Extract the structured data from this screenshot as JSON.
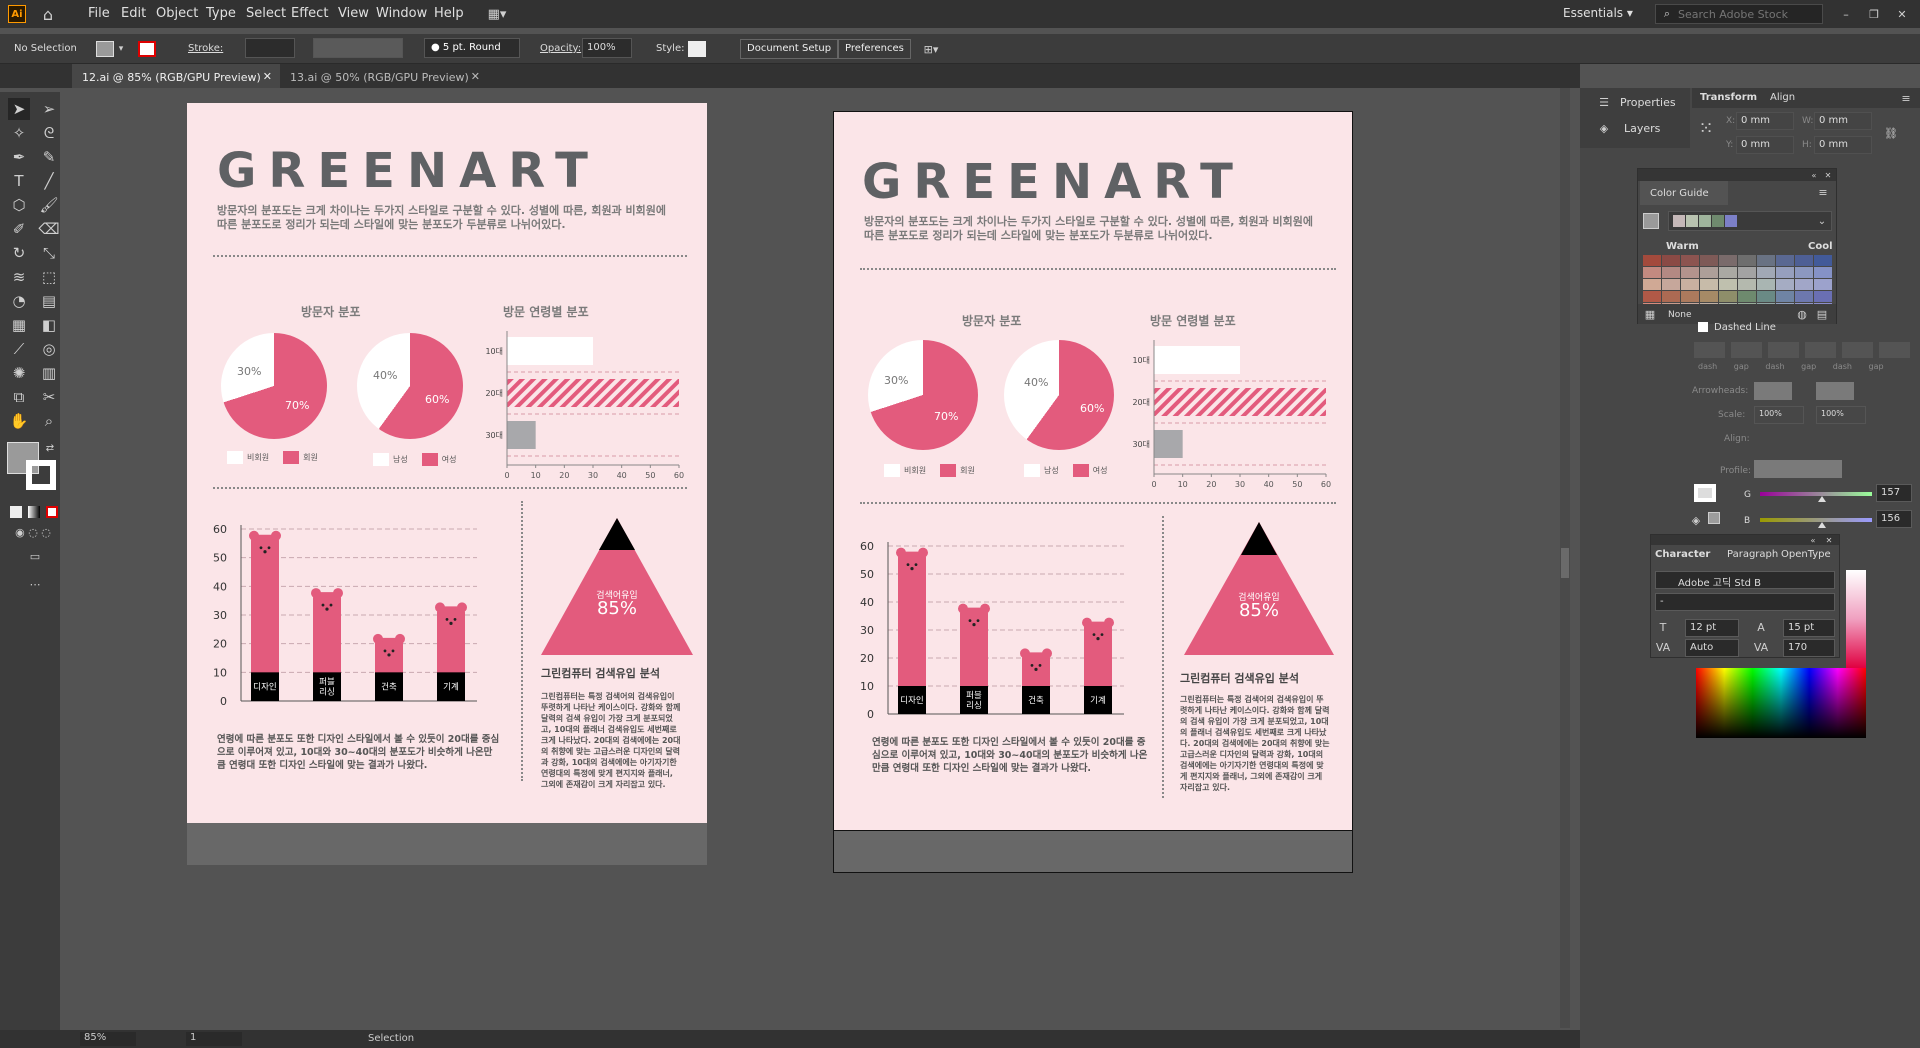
{
  "app": {
    "menu": [
      "File",
      "Edit",
      "Object",
      "Type",
      "Select",
      "Effect",
      "View",
      "Window",
      "Help"
    ],
    "workspace": "Essentials",
    "search_placeholder": "Search Adobe Stock",
    "logo": "Ai"
  },
  "control": {
    "selection": "No Selection",
    "stroke_label": "Stroke:",
    "brush": "5 pt. Round",
    "opacity_label": "Opacity:",
    "opacity": "100%",
    "style_label": "Style:",
    "doc_setup": "Document Setup",
    "preferences": "Preferences"
  },
  "tabs": [
    {
      "label": "12.ai @ 85% (RGB/GPU Preview)"
    },
    {
      "label": "13.ai @ 50% (RGB/GPU Preview)"
    }
  ],
  "status": {
    "zoom": "85%",
    "page": "1",
    "tool": "Selection"
  },
  "art": {
    "title": "GREENART",
    "intro1": "방문자의 분포도는 크게 차이나는 두가지 스타일로 구분할 수 있다. 성별에 따른, 회원과 비회원에",
    "intro2": "따른 분포도로 정리가 되는데 스타일에 맞는 분포도가 두분류로 나뉘어있다.",
    "visitor_title": "방문자 분포",
    "age_title": "방문 연령별 분포",
    "pie1": {
      "a": "30%",
      "b": "70%",
      "a_val": 30,
      "b_val": 70,
      "leg_a": "비회원",
      "leg_b": "회원"
    },
    "pie2": {
      "a": "40%",
      "b": "60%",
      "a_val": 40,
      "b_val": 60,
      "leg_a": "남성",
      "leg_b": "여성"
    },
    "age_bars": {
      "labels": [
        "10대",
        "20대",
        "30대"
      ],
      "values": [
        30,
        60,
        10
      ],
      "ticks": [
        "0",
        "10",
        "20",
        "30",
        "40",
        "50",
        "60"
      ]
    },
    "bear": {
      "ticks": [
        "0",
        "10",
        "20",
        "30",
        "40",
        "50",
        "60"
      ],
      "labels": [
        "디자인",
        "퍼블\n리싱",
        "건축",
        "기계"
      ],
      "values": [
        58,
        38,
        22,
        33
      ]
    },
    "tri_label": "검색어유입",
    "tri_value": "85%",
    "search_title": "그린컴퓨터 검색유입 분석",
    "search_body": "그린컴퓨터는 특정 검색어의 검색유입이 뚜렷하게 나타난 케이스이다. 강화와 함께 달력의 검색 유입이 가장 크게 분포되었고, 10대의 플래너 검색유입도 세번째로 크게 나타났다. 20대의 검색에에는 20대의 취향에 맞는 고급스러운 디자인의 달력과 강화, 10대의 검색에에는 아기자기한 연령대의 특정에 맞게 편지지와 플래너, 그외에 존재감이 크게 자리잡고 있다.",
    "bear_body": "연령에 따른 분포도 또한 디자인 스타일에서 볼 수 있듯이 20대를 중심으로 이루어져 있고, 10대와 30~40대의 분포도가 비슷하게 나온만큼 연령대 또한 디자인 스타일에 맞는 결과가 나왔다."
  },
  "panels": {
    "properties": "Properties",
    "layers": "Layers",
    "transform": "Transform",
    "align": "Align",
    "x": "X:",
    "y": "Y:",
    "w": "W:",
    "h": "H:",
    "zero": "0 mm",
    "color_guide": "Color Guide",
    "warm": "Warm",
    "cool": "Cool",
    "none": "None",
    "dashed_line": "Dashed Line",
    "dash": "dash",
    "gap": "gap",
    "arrowheads": "Arrowheads:",
    "scale": "Scale:",
    "scale_val": "100%",
    "align_lbl": "Align:",
    "profile": "Profile:",
    "g_label": "G",
    "g_val": "157",
    "b_label": "B",
    "b_val": "156",
    "character": "Character",
    "paragraph": "Paragraph",
    "opentype": "OpenType",
    "font": "Adobe 고딕 Std B",
    "font_style": "-",
    "size": "12 pt",
    "leading": "15 pt",
    "kerning": "Auto",
    "tracking": "170"
  },
  "colors": {
    "pink": "#e35b7d",
    "black": "#000000",
    "bar_grey": "#a8a8ab"
  },
  "swatches": [
    [
      "#a34a3c",
      "#8a4a45",
      "#8c5450",
      "#7e5a57",
      "#7a6b6b",
      "#6e6e6e",
      "#697283",
      "#5a6892",
      "#4e5f95",
      "#425a99"
    ],
    [
      "#c38a80",
      "#b38983",
      "#b3938d",
      "#ad9f99",
      "#aaa9a3",
      "#a3a3a3",
      "#a1a8b5",
      "#969fbe",
      "#8c98c0",
      "#8592c6"
    ],
    [
      "#d0a995",
      "#c6a79b",
      "#c9b0a0",
      "#c7bba9",
      "#bfc0ae",
      "#b4b9ae",
      "#a9b5b2",
      "#a5acc3",
      "#a1a6c8",
      "#9ca2cc"
    ],
    [
      "#b15947",
      "#ac6a53",
      "#ac7a5d",
      "#a68a66",
      "#8e8e6a",
      "#6e8a6e",
      "#6a8a85",
      "#6f84a4",
      "#6d78ae",
      "#6a6fb3"
    ],
    [
      "#d78a7c",
      "#c99b8c",
      "#c7a79b",
      "#c1b0a3",
      "#aab3a4",
      "#97ad9a",
      "#91a7a5",
      "#93a2bf",
      "#8f95c7",
      "#8b8dcc"
    ]
  ],
  "guide_chips": [
    "#c5b8b8",
    "#b9c3b0",
    "#9fb49c",
    "#6f8a6e",
    "#7c80c8"
  ]
}
